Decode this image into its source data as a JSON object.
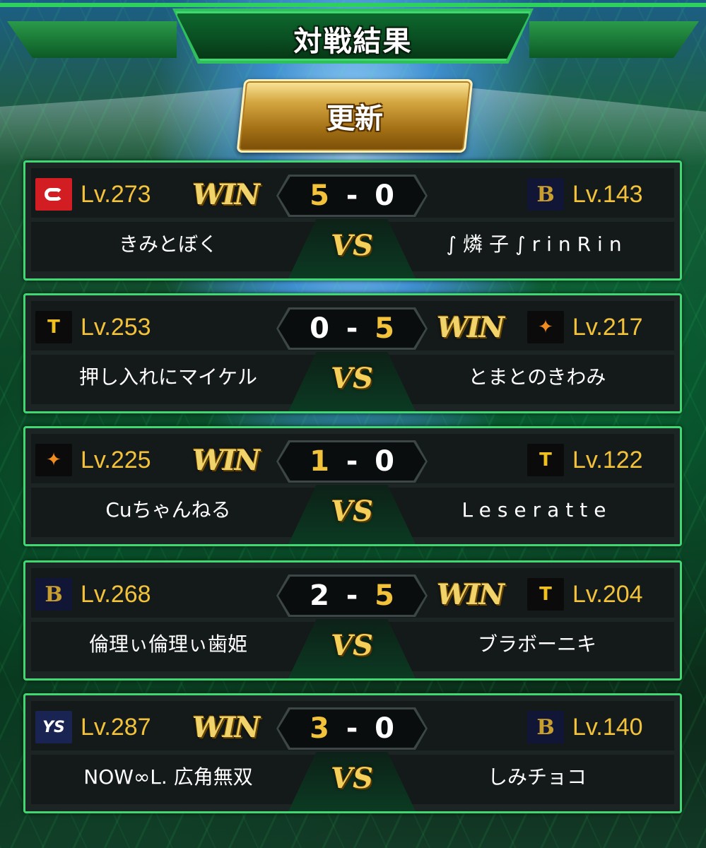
{
  "title": "対戦結果",
  "refresh_label": "更新",
  "vs_label": "VS",
  "win_label": "WIN",
  "score_separator": "-",
  "colors": {
    "accent_green": "#3fd873",
    "gold": "#f3c23b",
    "card_bg": "#1d2424"
  },
  "matches": [
    {
      "left": {
        "team_icon": "carp-logo-icon",
        "level": "Lv.273",
        "name": "きみとぼく",
        "score": "5",
        "win": true
      },
      "right": {
        "team_icon": "buffaloes-logo-icon",
        "level": "Lv.143",
        "name": "∫燐子∫rinRin",
        "score": "0",
        "win": false
      }
    },
    {
      "left": {
        "team_icon": "tigers-logo-icon",
        "level": "Lv.253",
        "name": "押し入れにマイケル",
        "score": "0",
        "win": false
      },
      "right": {
        "team_icon": "giants-logo-icon",
        "level": "Lv.217",
        "name": "とまとのきわみ",
        "score": "5",
        "win": true
      }
    },
    {
      "left": {
        "team_icon": "giants-logo-icon",
        "level": "Lv.225",
        "name": "Cuちゃんねる",
        "score": "1",
        "win": true
      },
      "right": {
        "team_icon": "tigers-logo-icon",
        "level": "Lv.122",
        "name": "Leseratte",
        "score": "0",
        "win": false
      }
    },
    {
      "left": {
        "team_icon": "buffaloes-logo-icon",
        "level": "Lv.268",
        "name": "倫理ぃ倫理ぃ歯姫",
        "score": "2",
        "win": false
      },
      "right": {
        "team_icon": "tigers-logo-icon",
        "level": "Lv.204",
        "name": "ブラボーニキ",
        "score": "5",
        "win": true
      }
    },
    {
      "left": {
        "team_icon": "swallows-logo-icon",
        "level": "Lv.287",
        "name": "NOW∞L. 広角無双",
        "score": "3",
        "win": true
      },
      "right": {
        "team_icon": "buffaloes-logo-icon",
        "level": "Lv.140",
        "name": "しみチョコ",
        "score": "0",
        "win": false
      }
    }
  ]
}
